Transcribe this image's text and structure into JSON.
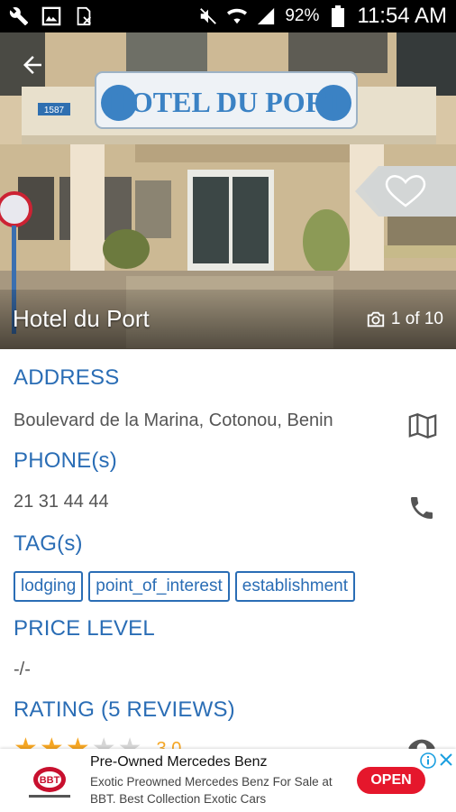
{
  "status_bar": {
    "battery": "92%",
    "time": "11:54 AM",
    "icons": [
      "wrench-icon",
      "image-icon",
      "sim-off-icon",
      "mute-icon",
      "wifi-icon",
      "signal-icon",
      "battery-icon"
    ]
  },
  "hero": {
    "title": "Hotel du Port",
    "photo_counter": "1 of 10",
    "sign_text": "HOTEL DU PORT",
    "plate_number": "1587"
  },
  "sections": {
    "address_label": "ADDRESS",
    "address_value": "Boulevard de la Marina, Cotonou, Benin",
    "phone_label": "PHONE(s)",
    "phone_value": "21 31 44 44",
    "tags_label": "TAG(s)",
    "tags": [
      "lodging",
      "point_of_interest",
      "establishment"
    ],
    "price_label": "PRICE LEVEL",
    "price_value": "-/-",
    "rating_label": "RATING (5 REVIEWS)",
    "rating_value": "3.0",
    "rating_stars": 3
  },
  "ad": {
    "title": "Pre-Owned Mercedes Benz",
    "description": "Exotic Preowned Mercedes Benz For Sale at BBT. Best Collection Exotic Cars",
    "cta": "OPEN",
    "logo_text": "BBT"
  },
  "colors": {
    "accent": "#2a6db5",
    "star": "#f5a623",
    "cta": "#e5172c"
  }
}
